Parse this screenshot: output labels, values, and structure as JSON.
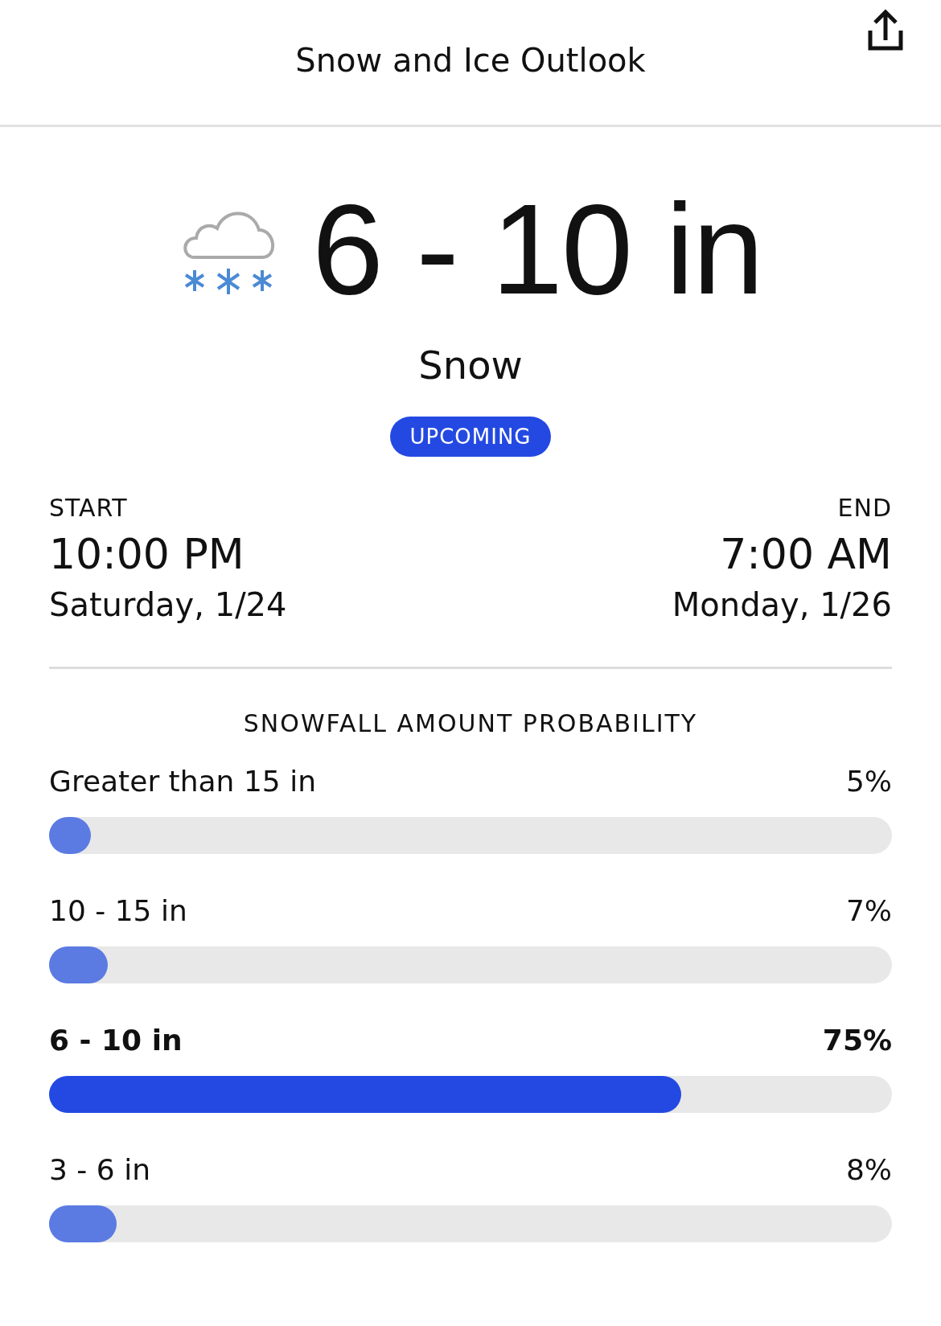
{
  "header": {
    "title": "Snow and Ice Outlook"
  },
  "forecast": {
    "amount": "6 - 10 in",
    "type": "Snow",
    "status": "UPCOMING"
  },
  "start": {
    "label": "START",
    "time": "10:00 PM",
    "date": "Saturday, 1/24"
  },
  "end": {
    "label": "END",
    "time": "7:00 AM",
    "date": "Monday, 1/26"
  },
  "probability": {
    "heading": "SNOWFALL AMOUNT PROBABILITY",
    "rows": [
      {
        "label": "Greater than 15 in",
        "percent": "5%",
        "level": 0.05,
        "highlighted": false
      },
      {
        "label": "10 - 15 in",
        "percent": "7%",
        "level": 0.07,
        "highlighted": false
      },
      {
        "label": "6 - 10 in",
        "percent": "75%",
        "level": 0.75,
        "highlighted": true
      },
      {
        "label": "3 - 6 in",
        "percent": "8%",
        "level": 0.08,
        "highlighted": false
      }
    ]
  }
}
